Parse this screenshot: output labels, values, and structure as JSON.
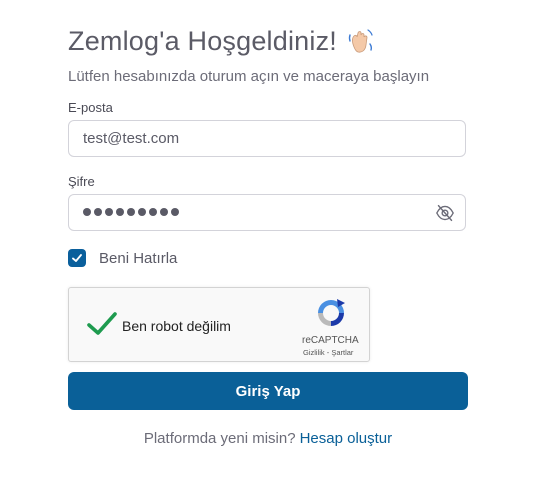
{
  "header": {
    "title": "Zemlog'a Hoşgeldiniz!",
    "subtitle": "Lütfen hesabınızda oturum açın ve maceraya başlayın",
    "wave_icon": "waving-hand-icon"
  },
  "form": {
    "email_label": "E-posta",
    "email_value": "test@test.com",
    "password_label": "Şifre",
    "password_masked_length": 9,
    "password_toggle_icon": "eye-slash-icon",
    "remember_label": "Beni Hatırla",
    "remember_checked": true,
    "submit_label": "Giriş Yap"
  },
  "recaptcha": {
    "label": "Ben robot değilim",
    "checked": true,
    "brand": "reCAPTCHA",
    "links": "Gizlilik - Şartlar"
  },
  "footer": {
    "prompt": "Platformda yeni misin?",
    "link_label": "Hesap oluştur"
  },
  "colors": {
    "primary": "#0a6098",
    "check_green": "#1e9b4f",
    "text": "#5b5b66"
  }
}
